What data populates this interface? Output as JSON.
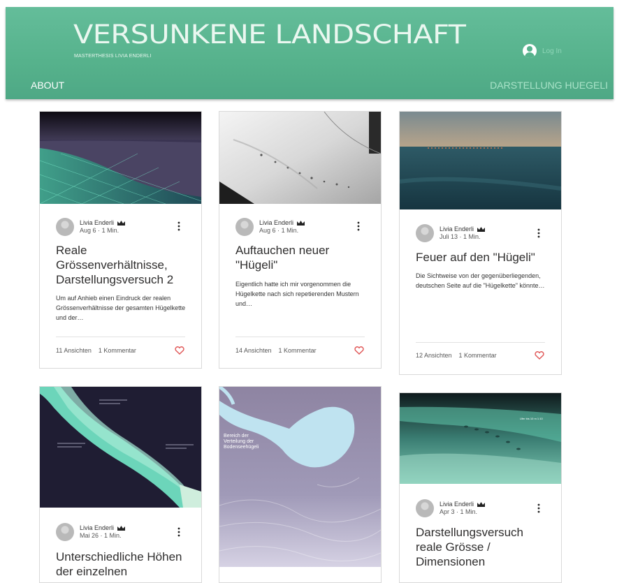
{
  "header": {
    "title": "VERSUNKENE LANDSCHAFT",
    "subtitle": "MASTERTHESIS LIVIA ENDERLI",
    "login_label": "Log In",
    "nav": {
      "about": "ABOUT",
      "right": "DARSTELLUNG HUEGELI"
    }
  },
  "colors": {
    "header_green": "#56b28c",
    "heart_red": "#e05555"
  },
  "posts": [
    {
      "author": "Livia Enderli",
      "date": "Aug 6",
      "read": "1 Min.",
      "title": "Reale Grössenverhältnisse, Darstellungsversuch 2",
      "excerpt": "Um auf Anhieb einen Eindruck der realen Grössenverhältnisse der gesamten Hügelkette und der…",
      "views": "11 Ansichten",
      "comments": "1 Kommentar"
    },
    {
      "author": "Livia Enderli",
      "date": "Aug 6",
      "read": "1 Min.",
      "title": "Auftauchen neuer \"Hügeli\"",
      "excerpt": "Eigentlich hatte ich mir vorgenommen die Hügelkette nach sich repetierenden Mustern und…",
      "views": "14 Ansichten",
      "comments": "1 Kommentar"
    },
    {
      "author": "Livia Enderli",
      "date": "Juli 13",
      "read": "1 Min.",
      "title": "Feuer auf den \"Hügeli\"",
      "excerpt": "Die Sichtweise von der gegenüberliegenden, deutschen Seite auf die \"Hügelkette\" könnte…",
      "views": "12 Ansichten",
      "comments": "1 Kommentar"
    },
    {
      "author": "Livia Enderli",
      "date": "Mai 26",
      "read": "1 Min.",
      "title": "Unterschiedliche Höhen der einzelnen"
    },
    {
      "map_label": "Bereich der Verteilung der Bodenseehügeli"
    },
    {
      "author": "Livia Enderli",
      "date": "Apr 3",
      "read": "1 Min.",
      "title": "Darstellungsversuch reale Grösse / Dimensionen",
      "image_caption": "Ufer bis 10 m 1:10"
    }
  ],
  "misc": {
    "dot": "·",
    "more_icon": "kebab-icon",
    "like_icon": "heart-icon",
    "owner_icon": "crown-icon"
  }
}
